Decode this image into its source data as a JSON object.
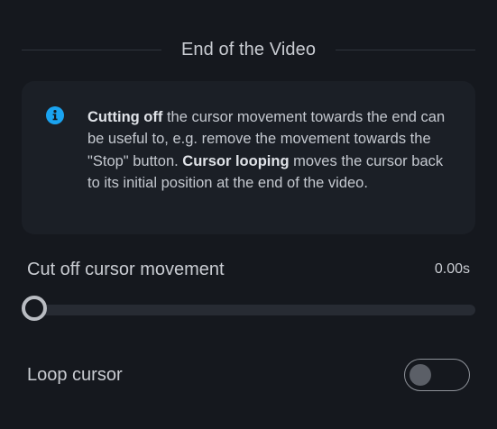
{
  "section": {
    "title": "End of the Video"
  },
  "info": {
    "icon": "info-icon",
    "accent_color": "#1aa3f0",
    "bold1": "Cutting off",
    "text1": " the cursor movement towards the end can be useful to, e.g. remove the movement towards the \"Stop\" button. ",
    "bold2": "Cursor looping",
    "text2": " moves the cursor back to its initial position at the end of the video."
  },
  "cut_off": {
    "label": "Cut off cursor movement",
    "value_text": "0.00s",
    "slider_fraction": 0
  },
  "loop": {
    "label": "Loop cursor",
    "enabled": false
  }
}
